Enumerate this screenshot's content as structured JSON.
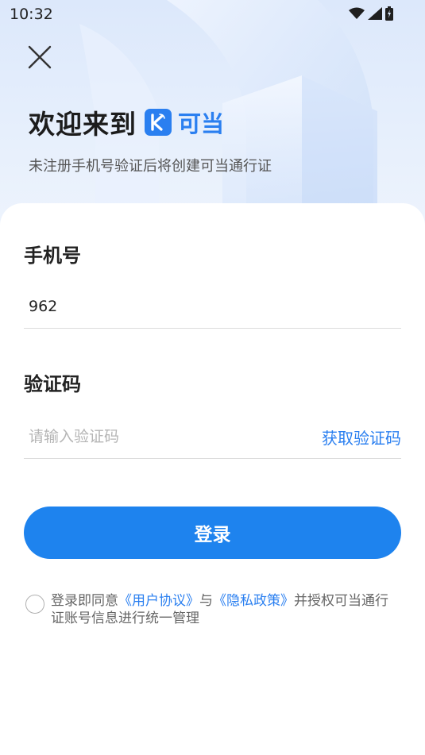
{
  "status_bar": {
    "time": "10:32",
    "icons": [
      "wifi-icon",
      "signal-icon",
      "battery-icon"
    ]
  },
  "header": {
    "close_icon": "close-icon",
    "welcome": "欢迎来到",
    "brand_logo_letter": "K",
    "brand_name": "可当",
    "subtitle": "未注册手机号验证后将创建可当通行证"
  },
  "form": {
    "phone_label": "手机号",
    "phone_value": "962",
    "code_label": "验证码",
    "code_placeholder": "请输入验证码",
    "get_code": "获取验证码",
    "login_button": "登录"
  },
  "agreement": {
    "prefix": "登录即同意",
    "user_agreement": "《用户协议》",
    "and": "与",
    "privacy_policy": "《隐私政策》",
    "suffix": "并授权可当通行证账号信息进行统一管理",
    "checked": false
  },
  "colors": {
    "accent": "#1e83ee",
    "brand": "#2a7ff0"
  }
}
